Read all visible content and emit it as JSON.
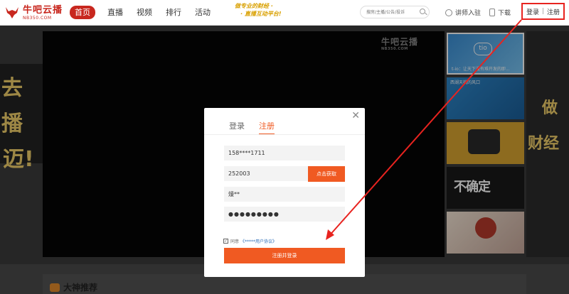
{
  "header": {
    "logo_name": "牛吧云播",
    "logo_domain": "NB350.COM",
    "nav": [
      "首页",
      "直播",
      "视频",
      "排行",
      "活动"
    ],
    "slogan_line1": "做专业的财经 ·",
    "slogan_line2": "· 直播互动平台!",
    "search_placeholder": "搜房/主播/公告/投诉",
    "lecturer_link": "讲师入驻",
    "download_link": "下载",
    "login": "登录",
    "divider": "|",
    "register": "注册"
  },
  "hero": {
    "left_line1": "去播",
    "left_line2": "迈!",
    "right_line1": "做",
    "right_line2": "财经"
  },
  "player": {
    "watermark": "牛吧云播",
    "watermark_sub": "NB350.COM"
  },
  "thumbs": [
    {
      "caption": "t-io：让天下没有难开发的即...",
      "logo": "tio"
    },
    {
      "caption": "西湖天桃的风口"
    },
    {
      "caption": ""
    },
    {
      "caption": "",
      "big": "不确定"
    },
    {
      "caption": ""
    }
  ],
  "section": {
    "title": "大神推荐"
  },
  "modal": {
    "close": "✕",
    "tab_login": "登录",
    "tab_register": "注册",
    "phone": "158****1711",
    "code": "252003",
    "get_code": "点击获取",
    "nickname": "熳**",
    "password": "●●●●●●●●●",
    "agree_text": "同意",
    "agree_link": "《*****用户协议》",
    "submit": "注册并登录",
    "check": "✓"
  },
  "colors": {
    "brand": "#c8271e",
    "accent": "#f05a22",
    "annotation": "#e8231f"
  }
}
